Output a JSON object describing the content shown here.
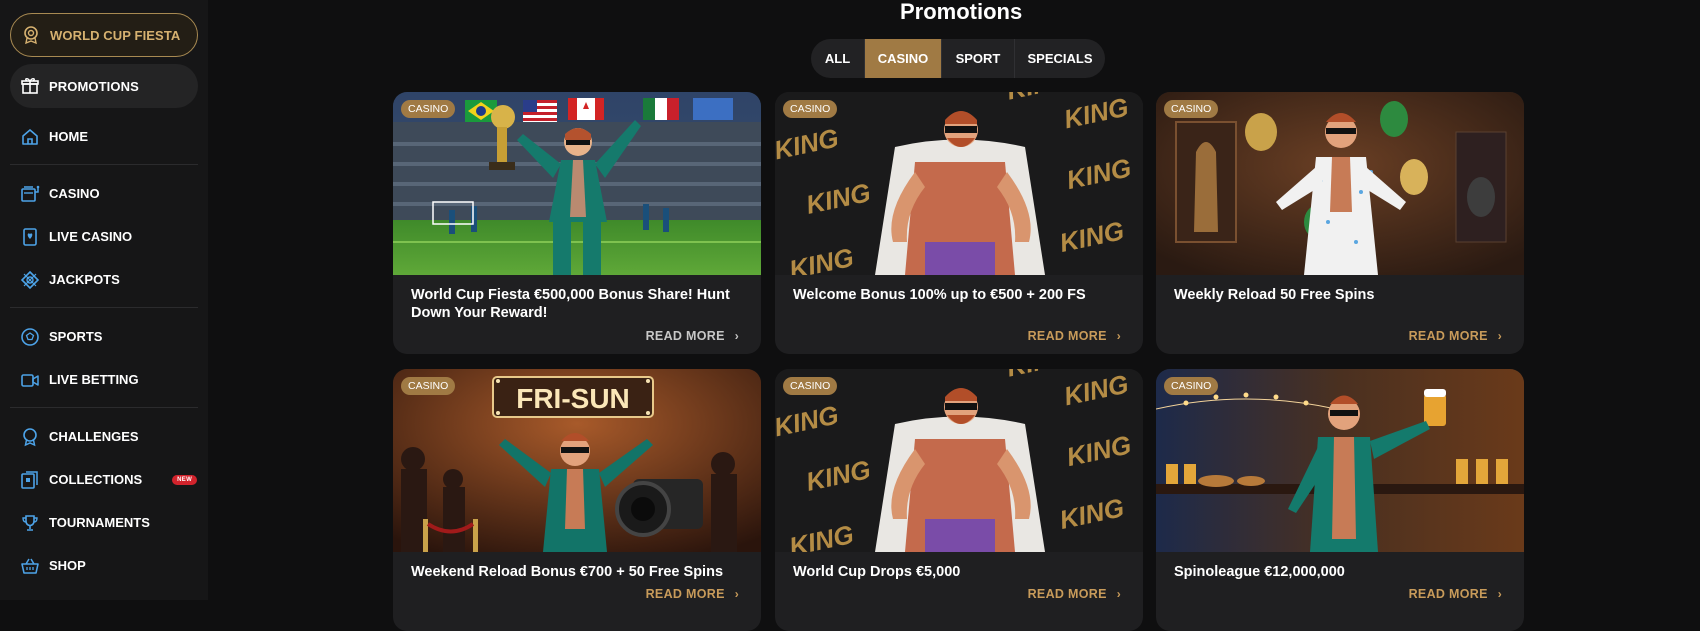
{
  "sidebar": {
    "fiesta_label": "WORLD CUP FIESTA",
    "promotions_label": "PROMOTIONS",
    "groups": [
      [
        {
          "label": "HOME",
          "icon": "home-icon"
        }
      ],
      [
        {
          "label": "CASINO",
          "icon": "slot-machine-icon"
        },
        {
          "label": "LIVE CASINO",
          "icon": "playing-card-icon"
        },
        {
          "label": "JACKPOTS",
          "icon": "jackpot-icon"
        }
      ],
      [
        {
          "label": "SPORTS",
          "icon": "soccer-ball-icon"
        },
        {
          "label": "LIVE BETTING",
          "icon": "video-camera-icon"
        }
      ],
      [
        {
          "label": "CHALLENGES",
          "icon": "medal-icon"
        },
        {
          "label": "COLLECTIONS",
          "icon": "collection-icon",
          "badge": "NEW"
        },
        {
          "label": "TOURNAMENTS",
          "icon": "trophy-icon"
        },
        {
          "label": "SHOP",
          "icon": "shop-basket-icon"
        }
      ]
    ]
  },
  "main": {
    "title": "Promotions",
    "tabs": [
      {
        "label": "ALL",
        "active": false
      },
      {
        "label": "CASINO",
        "active": true
      },
      {
        "label": "SPORT",
        "active": false
      },
      {
        "label": "SPECIALS",
        "active": false
      }
    ],
    "cards": [
      {
        "badge": "CASINO",
        "title": "World Cup Fiesta €500,000 Bonus Share! Hunt Down Your Reward!",
        "cta": "READ MORE",
        "cta_style": "grey",
        "art": "stadium"
      },
      {
        "badge": "CASINO",
        "title": "Welcome Bonus 100% up to €500 + 200 FS",
        "cta": "READ MORE",
        "cta_style": "gold",
        "art": "king"
      },
      {
        "badge": "CASINO",
        "title": "Weekly Reload 50 Free Spins",
        "cta": "READ MORE",
        "cta_style": "gold",
        "art": "museum"
      },
      {
        "badge": "CASINO",
        "title": "Weekend Reload Bonus €700 + 50 Free Spins",
        "cta": "READ MORE",
        "cta_style": "gold",
        "art": "frisun",
        "sign_text": "FRI-SUN"
      },
      {
        "badge": "CASINO",
        "title": "World Cup Drops €5,000",
        "cta": "READ MORE",
        "cta_style": "gold",
        "art": "king"
      },
      {
        "badge": "CASINO",
        "title": "Spinoleague €12,000,000",
        "cta": "READ MORE",
        "cta_style": "gold",
        "art": "pub"
      }
    ],
    "king_word": "KING"
  },
  "colors": {
    "accent_gold": "#a07a44",
    "read_more_gold": "#c89b5a",
    "background": "#0f0f10",
    "sidebar": "#161617",
    "card": "#1f1f21",
    "new_badge": "#d2232c"
  }
}
